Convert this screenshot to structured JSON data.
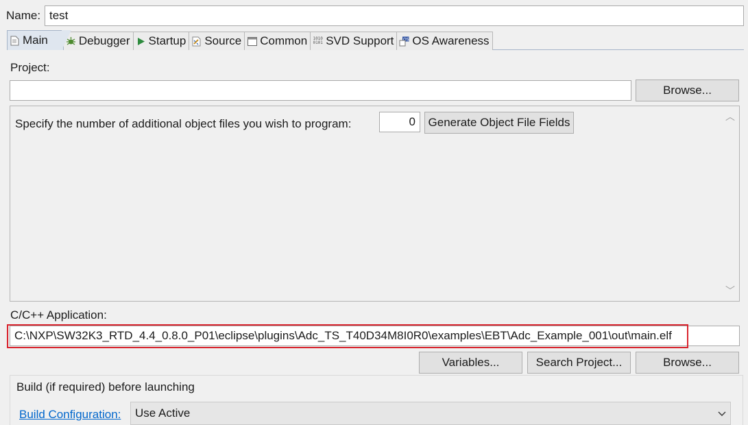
{
  "name": {
    "label": "Name:",
    "value": "test"
  },
  "tabs": [
    {
      "label": "Main",
      "icon": "document-icon",
      "active": true
    },
    {
      "label": "Debugger",
      "icon": "bug-icon"
    },
    {
      "label": "Startup",
      "icon": "play-icon"
    },
    {
      "label": "Source",
      "icon": "source-icon"
    },
    {
      "label": "Common",
      "icon": "window-icon"
    },
    {
      "label": "SVD Support",
      "icon": "binary-icon"
    },
    {
      "label": "OS Awareness",
      "icon": "os-icon"
    }
  ],
  "project": {
    "label": "Project:",
    "value": "",
    "browse_label": "Browse..."
  },
  "object_files": {
    "prompt": "Specify the number of additional object files you wish to program:",
    "count": "0",
    "generate_label": "Generate Object File Fields"
  },
  "application": {
    "label": "C/C++ Application:",
    "value": "C:\\NXP\\SW32K3_RTD_4.4_0.8.0_P01\\eclipse\\plugins\\Adc_TS_T40D34M8I0R0\\examples\\EBT\\Adc_Example_001\\out\\main.elf",
    "variables_label": "Variables...",
    "search_label": "Search Project...",
    "browse_label": "Browse..."
  },
  "build": {
    "group_title": "Build (if required) before launching",
    "config_link": "Build Configuration:",
    "config_value": "Use Active"
  },
  "colors": {
    "highlight_border": "#d9232d",
    "link": "#0066cc",
    "active_tab": "#dfe6ef"
  }
}
